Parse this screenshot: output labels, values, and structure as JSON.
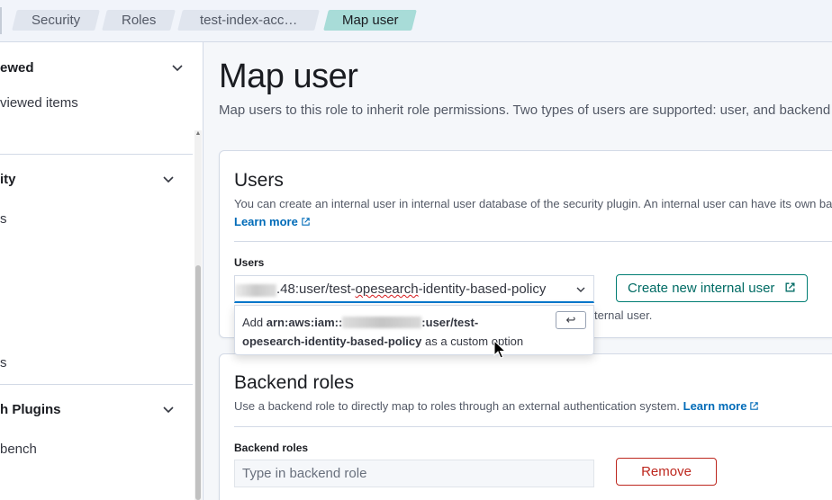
{
  "breadcrumbs": [
    "Security",
    "Roles",
    "test-index-acc…",
    "Map user"
  ],
  "sidebar": {
    "sections": [
      {
        "title": "ewed",
        "items": [
          "viewed items"
        ]
      },
      {
        "title": "ity",
        "items": [
          "s",
          "s"
        ]
      },
      {
        "title": "h Plugins",
        "items": [
          "bench"
        ]
      }
    ]
  },
  "page": {
    "title": "Map user",
    "description": "Map users to this role to inherit role permissions. Two types of users are supported: user, and backend ro"
  },
  "users_panel": {
    "title": "Users",
    "help": "You can create an internal user in internal user database of the security plugin. An internal user can have its own backen",
    "learn_more": "Learn more",
    "field_label": "Users",
    "combo_value_prefix": ".48:user/test-",
    "combo_value_squiggle": "opesearch",
    "combo_value_suffix": "-identity-based-policy",
    "dropdown_add": "Add",
    "dropdown_bold_prefix": "arn:aws:iam::",
    "dropdown_bold_suffix": ":user/test-opesearch-identity-based-policy",
    "dropdown_tail": "as a custom option",
    "enter_key": "↩",
    "create_button": "Create new internal user",
    "behind_text": "ternal user."
  },
  "backend_panel": {
    "title": "Backend roles",
    "help": "Use a backend role to directly map to roles through an external authentication system.",
    "learn_more": "Learn more",
    "field_label": "Backend roles",
    "input_placeholder": "Type in backend role",
    "remove_button": "Remove"
  },
  "colors": {
    "accent": "#017d73",
    "link": "#006bb8",
    "danger": "#bd271e",
    "active_crumb": "#a8dcd8"
  }
}
